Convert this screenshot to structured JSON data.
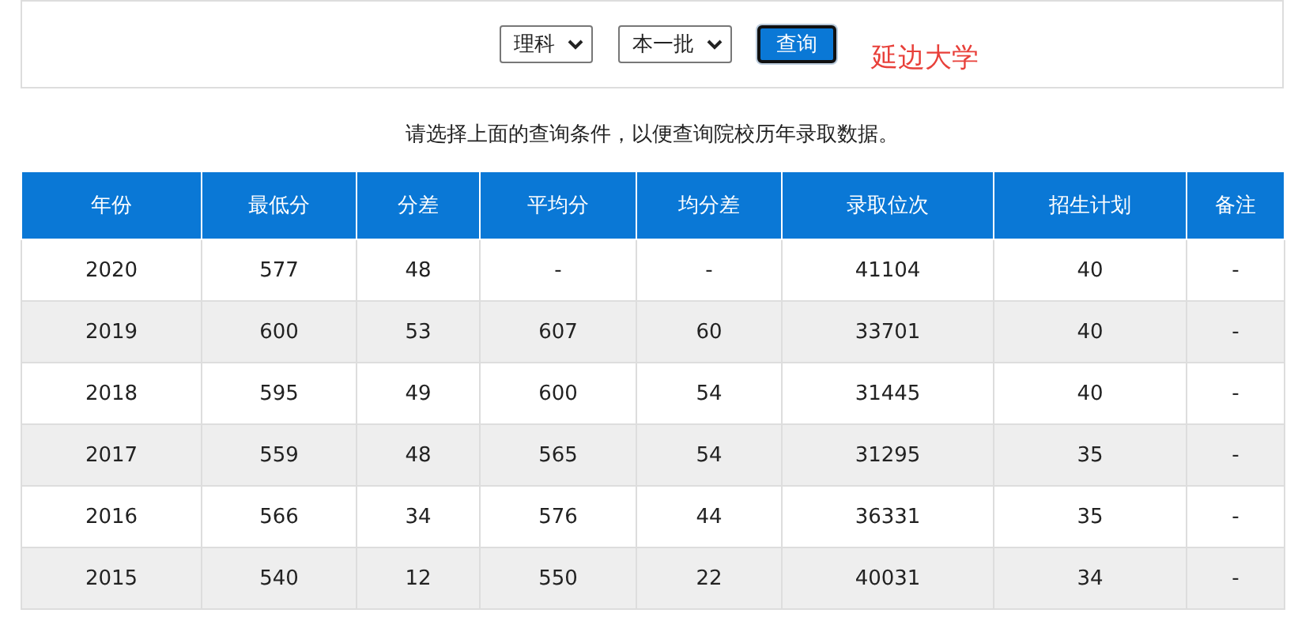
{
  "query_bar": {
    "dropdowns": [
      {
        "value": "理科"
      },
      {
        "value": "本一批"
      }
    ],
    "button": "查询",
    "school": "延边大学"
  },
  "hint": "请选择上面的查询条件，以便查询院校历年录取数据。",
  "table": {
    "columns": [
      "年份",
      "最低分",
      "分差",
      "平均分",
      "均分差",
      "录取位次",
      "招生计划",
      "备注"
    ],
    "rows": [
      [
        "2020",
        "577",
        "48",
        "-",
        "-",
        "41104",
        "40",
        "-"
      ],
      [
        "2019",
        "600",
        "53",
        "607",
        "60",
        "33701",
        "40",
        "-"
      ],
      [
        "2018",
        "595",
        "49",
        "600",
        "54",
        "31445",
        "40",
        "-"
      ],
      [
        "2017",
        "559",
        "48",
        "565",
        "54",
        "31295",
        "35",
        "-"
      ],
      [
        "2016",
        "566",
        "34",
        "576",
        "44",
        "36331",
        "35",
        "-"
      ],
      [
        "2015",
        "540",
        "12",
        "550",
        "22",
        "40031",
        "34",
        "-"
      ]
    ]
  }
}
